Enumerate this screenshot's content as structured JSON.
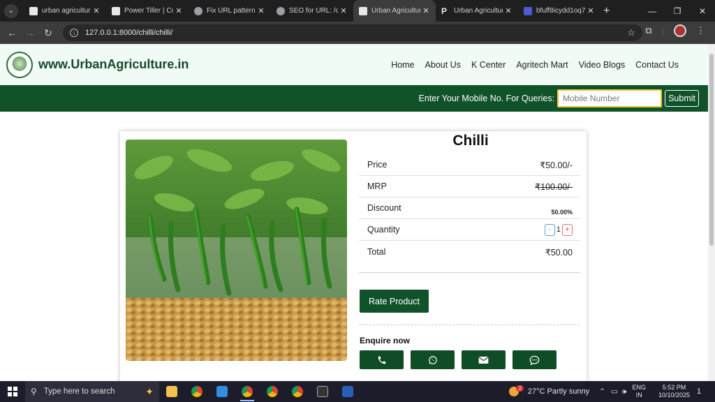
{
  "browser": {
    "tabs": [
      {
        "title": "urban agricultur",
        "icon": "site-favicon",
        "active": false
      },
      {
        "title": "Power Tiller | Co",
        "icon": "site-favicon",
        "active": false
      },
      {
        "title": "Fix URL patterns",
        "icon": "chatgpt-favicon",
        "active": false
      },
      {
        "title": "SEO for URL: /co",
        "icon": "globe-favicon",
        "active": false
      },
      {
        "title": "Urban Agricultur",
        "icon": "site-favicon",
        "active": true
      },
      {
        "title": "Urban Agricultur",
        "icon": "p-favicon",
        "active": false
      },
      {
        "title": "bfuff8icydd1oq7",
        "icon": "blue-favicon",
        "active": false
      }
    ],
    "url": "127.0.0.1:8000/chilli/chilli/"
  },
  "site": {
    "brand": "www.UrbanAgriculture.in",
    "nav": [
      "Home",
      "About Us",
      "K Center",
      "Agritech Mart",
      "Video Blogs",
      "Contact Us"
    ],
    "query_label": "Enter Your Mobile No. For Queries:",
    "mobile_placeholder": "Mobile Number",
    "submit_label": "Submit"
  },
  "product": {
    "name": "Chilli",
    "price_label": "Price",
    "price": "₹50.00/-",
    "mrp_label": "MRP",
    "mrp": "₹100.00/-",
    "discount_label": "Discount",
    "discount": "50.00%",
    "quantity_label": "Quantity",
    "quantity": "1",
    "minus": "-",
    "plus": "+",
    "total_label": "Total",
    "total": "₹50.00",
    "rate_button": "Rate Product",
    "enquire_label": "Enquire now",
    "enquire_icons": [
      "phone-icon",
      "whatsapp-icon",
      "email-icon",
      "chat-icon"
    ]
  },
  "taskbar": {
    "search_placeholder": "Type here to search",
    "weather": "27°C  Partly sunny",
    "weather_badge": "2",
    "lang_top": "ENG",
    "lang_bottom": "IN",
    "time": "5:52 PM",
    "date": "10/10/2025",
    "notifications": "1"
  },
  "colors": {
    "brand_green": "#10532a",
    "header_bg": "#f1fbf5",
    "input_border": "#f3c534"
  }
}
